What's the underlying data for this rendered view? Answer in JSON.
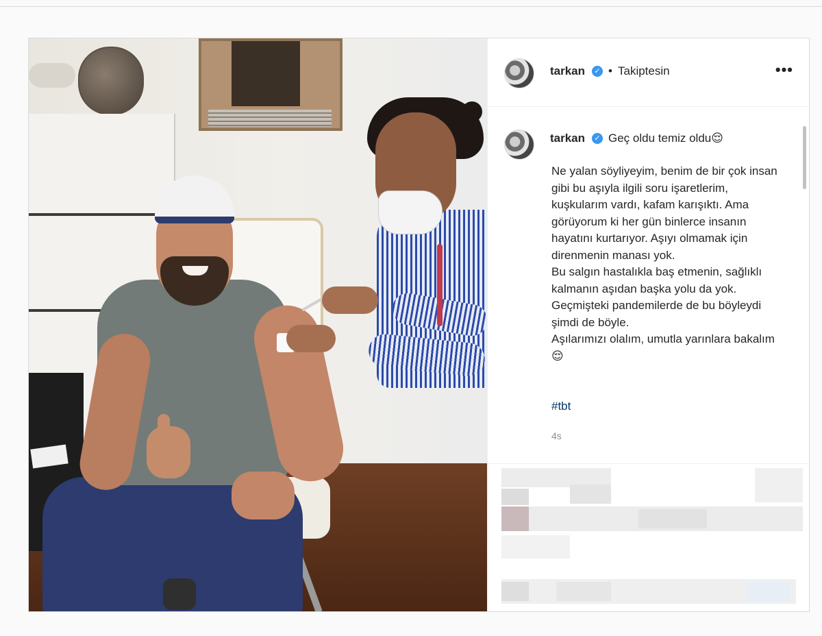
{
  "post": {
    "author": {
      "username": "tarkan",
      "verified_icon": "verified-badge-icon",
      "follow_separator": "•",
      "follow_status": "Takiptesin"
    },
    "more_icon": "more-options-icon",
    "more_label": "•••",
    "caption": {
      "username": "tarkan",
      "headline": "Geç oldu temiz oldu😌",
      "body": "Ne yalan söyliyeyim, benim de bir çok insan gibi bu aşıyla ilgili soru işaretlerim, kuşkularım vardı, kafam karışıktı. Ama görüyorum ki her gün binlerce insanın hayatını kurtarıyor. Aşıyı olmamak için direnmenin manası yok.\nBu salgın hastalıkla baş etmenin, sağlıklı kalmanın aşıdan başka yolu da yok. Geçmişteki pandemilerde de bu böyleydi şimdi de böyle.\nAşılarımızı olalım, umutla yarınlara bakalım😌",
      "hashtag": "#tbt",
      "time_ago": "4s"
    },
    "colors": {
      "verified_blue": "#3897f0",
      "hashtag_link": "#00376b",
      "muted_text": "#8e8e8e",
      "border": "#dbdbdb"
    }
  }
}
